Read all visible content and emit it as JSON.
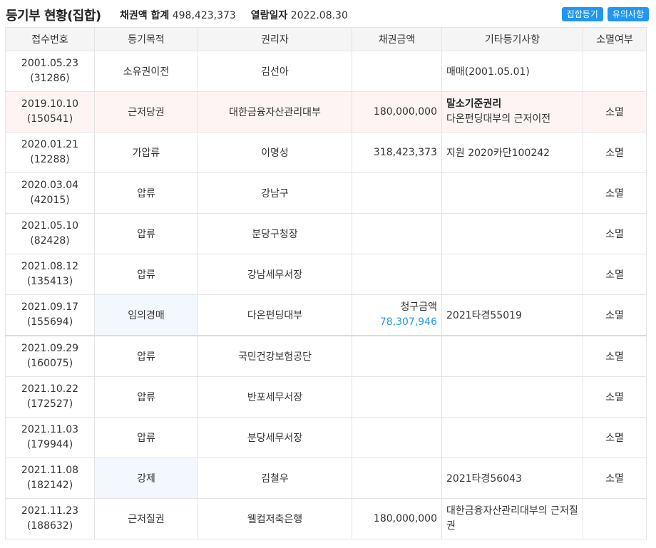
{
  "header": {
    "title": "등기부 현황(집합)",
    "total_label": "채권액 합계",
    "total_value": "498,423,373",
    "date_label": "열람일자",
    "date_value": "2022.08.30",
    "btn_collective": "집합등기",
    "btn_notes": "유의사항"
  },
  "columns": [
    "접수번호",
    "등기목적",
    "권리자",
    "채권금액",
    "기타등기사항",
    "소멸여부"
  ],
  "rows": [
    {
      "date": "2001.05.23",
      "num": "(31286)",
      "purpose": "소유권이전",
      "holder": "김선아",
      "amount": "",
      "etc": "매매(2001.05.01)",
      "status": ""
    },
    {
      "date": "2019.10.10",
      "num": "(150541)",
      "purpose": "근저당권",
      "holder": "대한금융자산관리대부",
      "amount": "180,000,000",
      "etc_bold": "말소기준권리",
      "etc": "다온펀딩대부의 근저이전",
      "status": "소멸"
    },
    {
      "date": "2020.01.21",
      "num": "(12288)",
      "purpose": "가압류",
      "holder": "이명성",
      "amount": "318,423,373",
      "etc": "지원 2020카단100242",
      "status": "소멸"
    },
    {
      "date": "2020.03.04",
      "num": "(42015)",
      "purpose": "압류",
      "holder": "강남구",
      "amount": "",
      "etc": "",
      "status": "소멸"
    },
    {
      "date": "2021.05.10",
      "num": "(82428)",
      "purpose": "압류",
      "holder": "분당구청장",
      "amount": "",
      "etc": "",
      "status": "소멸"
    },
    {
      "date": "2021.08.12",
      "num": "(135413)",
      "purpose": "압류",
      "holder": "강남세무서장",
      "amount": "",
      "etc": "",
      "status": "소멸"
    },
    {
      "date": "2021.09.17",
      "num": "(155694)",
      "purpose": "임의경매",
      "holder": "다온펀딩대부",
      "amount_label": "청구금액",
      "amount": "78,307,946",
      "etc": "2021타경55019",
      "status": "소멸"
    },
    {
      "date": "2021.09.29",
      "num": "(160075)",
      "purpose": "압류",
      "holder": "국민건강보험공단",
      "amount": "",
      "etc": "",
      "status": "소멸"
    },
    {
      "date": "2021.10.22",
      "num": "(172527)",
      "purpose": "압류",
      "holder": "반포세무서장",
      "amount": "",
      "etc": "",
      "status": "소멸"
    },
    {
      "date": "2021.11.03",
      "num": "(179944)",
      "purpose": "압류",
      "holder": "분당세무서장",
      "amount": "",
      "etc": "",
      "status": "소멸"
    },
    {
      "date": "2021.11.08",
      "num": "(182142)",
      "purpose": "강제",
      "holder": "김철우",
      "amount": "",
      "etc": "2021타경56043",
      "status": "소멸"
    },
    {
      "date": "2021.11.23",
      "num": "(188632)",
      "purpose": "근저질권",
      "holder": "웰컴저축은행",
      "amount": "180,000,000",
      "etc": "대한금융자산관리대부의 근저질권",
      "status": ""
    }
  ]
}
